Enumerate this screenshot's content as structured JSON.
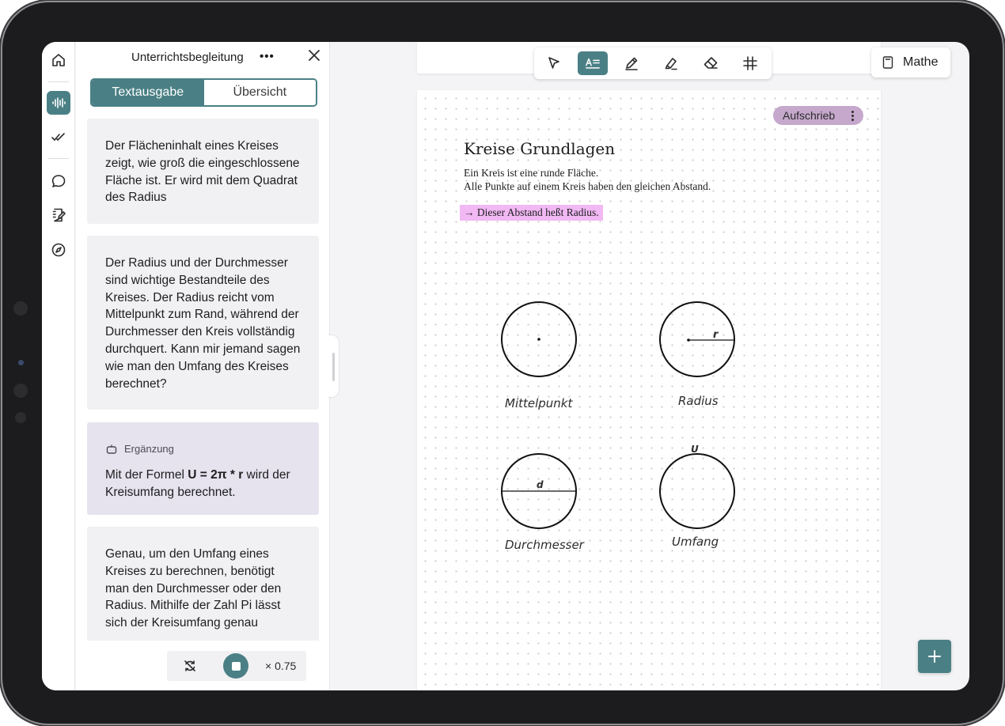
{
  "panel": {
    "title": "Unterrichtsbegleitung",
    "tabs": [
      "Textausgabe",
      "Übersicht"
    ],
    "cards": [
      {
        "text": "Der Flächeninhalt eines Kreises zeigt, wie groß die eingeschlossene Fläche ist. Er wird mit dem Quadrat des Radius"
      },
      {
        "text": "Der Radius und der Durchmesser sind wichtige Bestandteile des Kreises. Der Radius reicht vom Mittelpunkt zum Rand, während der Durchmesser den Kreis vollständig durchquert. Kann mir jemand sagen wie man den Umfang des Kreises berechnet?"
      },
      {
        "tag": "Ergänzung",
        "text_before": "Mit der Formel ",
        "formula": "U = 2π * r",
        "text_after": " wird der Kreisumfang berechnet."
      },
      {
        "text": "Genau, um den Umfang eines Kreises zu berechnen, benötigt man den Durchmesser oder den Radius. Mithilfe der Zahl Pi lässt sich der Kreisumfang genau"
      }
    ],
    "player": {
      "speed": "× 0.75"
    }
  },
  "toolbar": {
    "tools": [
      "pointer-icon",
      "text-icon",
      "pen-icon",
      "highlighter-icon",
      "eraser-icon",
      "grid-icon"
    ],
    "active_tool": "text-icon"
  },
  "subject": {
    "label": "Mathe"
  },
  "document": {
    "chip_label": "Aufschrieb",
    "title": "Kreise Grundlagen",
    "lines": [
      "Ein Kreis ist eine runde Fläche.",
      "Alle Punkte auf einem Kreis haben den gleichen Abstand."
    ],
    "highlight": "→ Dieser Abstand heßt Radius.",
    "sketch_labels": {
      "mittelpunkt": "Mittelpunkt",
      "radius": "Radius",
      "durchmesser": "Durchmesser",
      "umfang": "Umfang",
      "r": "r",
      "d": "d",
      "u": "U"
    }
  },
  "colors": {
    "accent": "#4a8085",
    "highlight": "#f1b8f3",
    "chip": "#c5a8cb",
    "card_highlight": "#e6e3ee"
  }
}
